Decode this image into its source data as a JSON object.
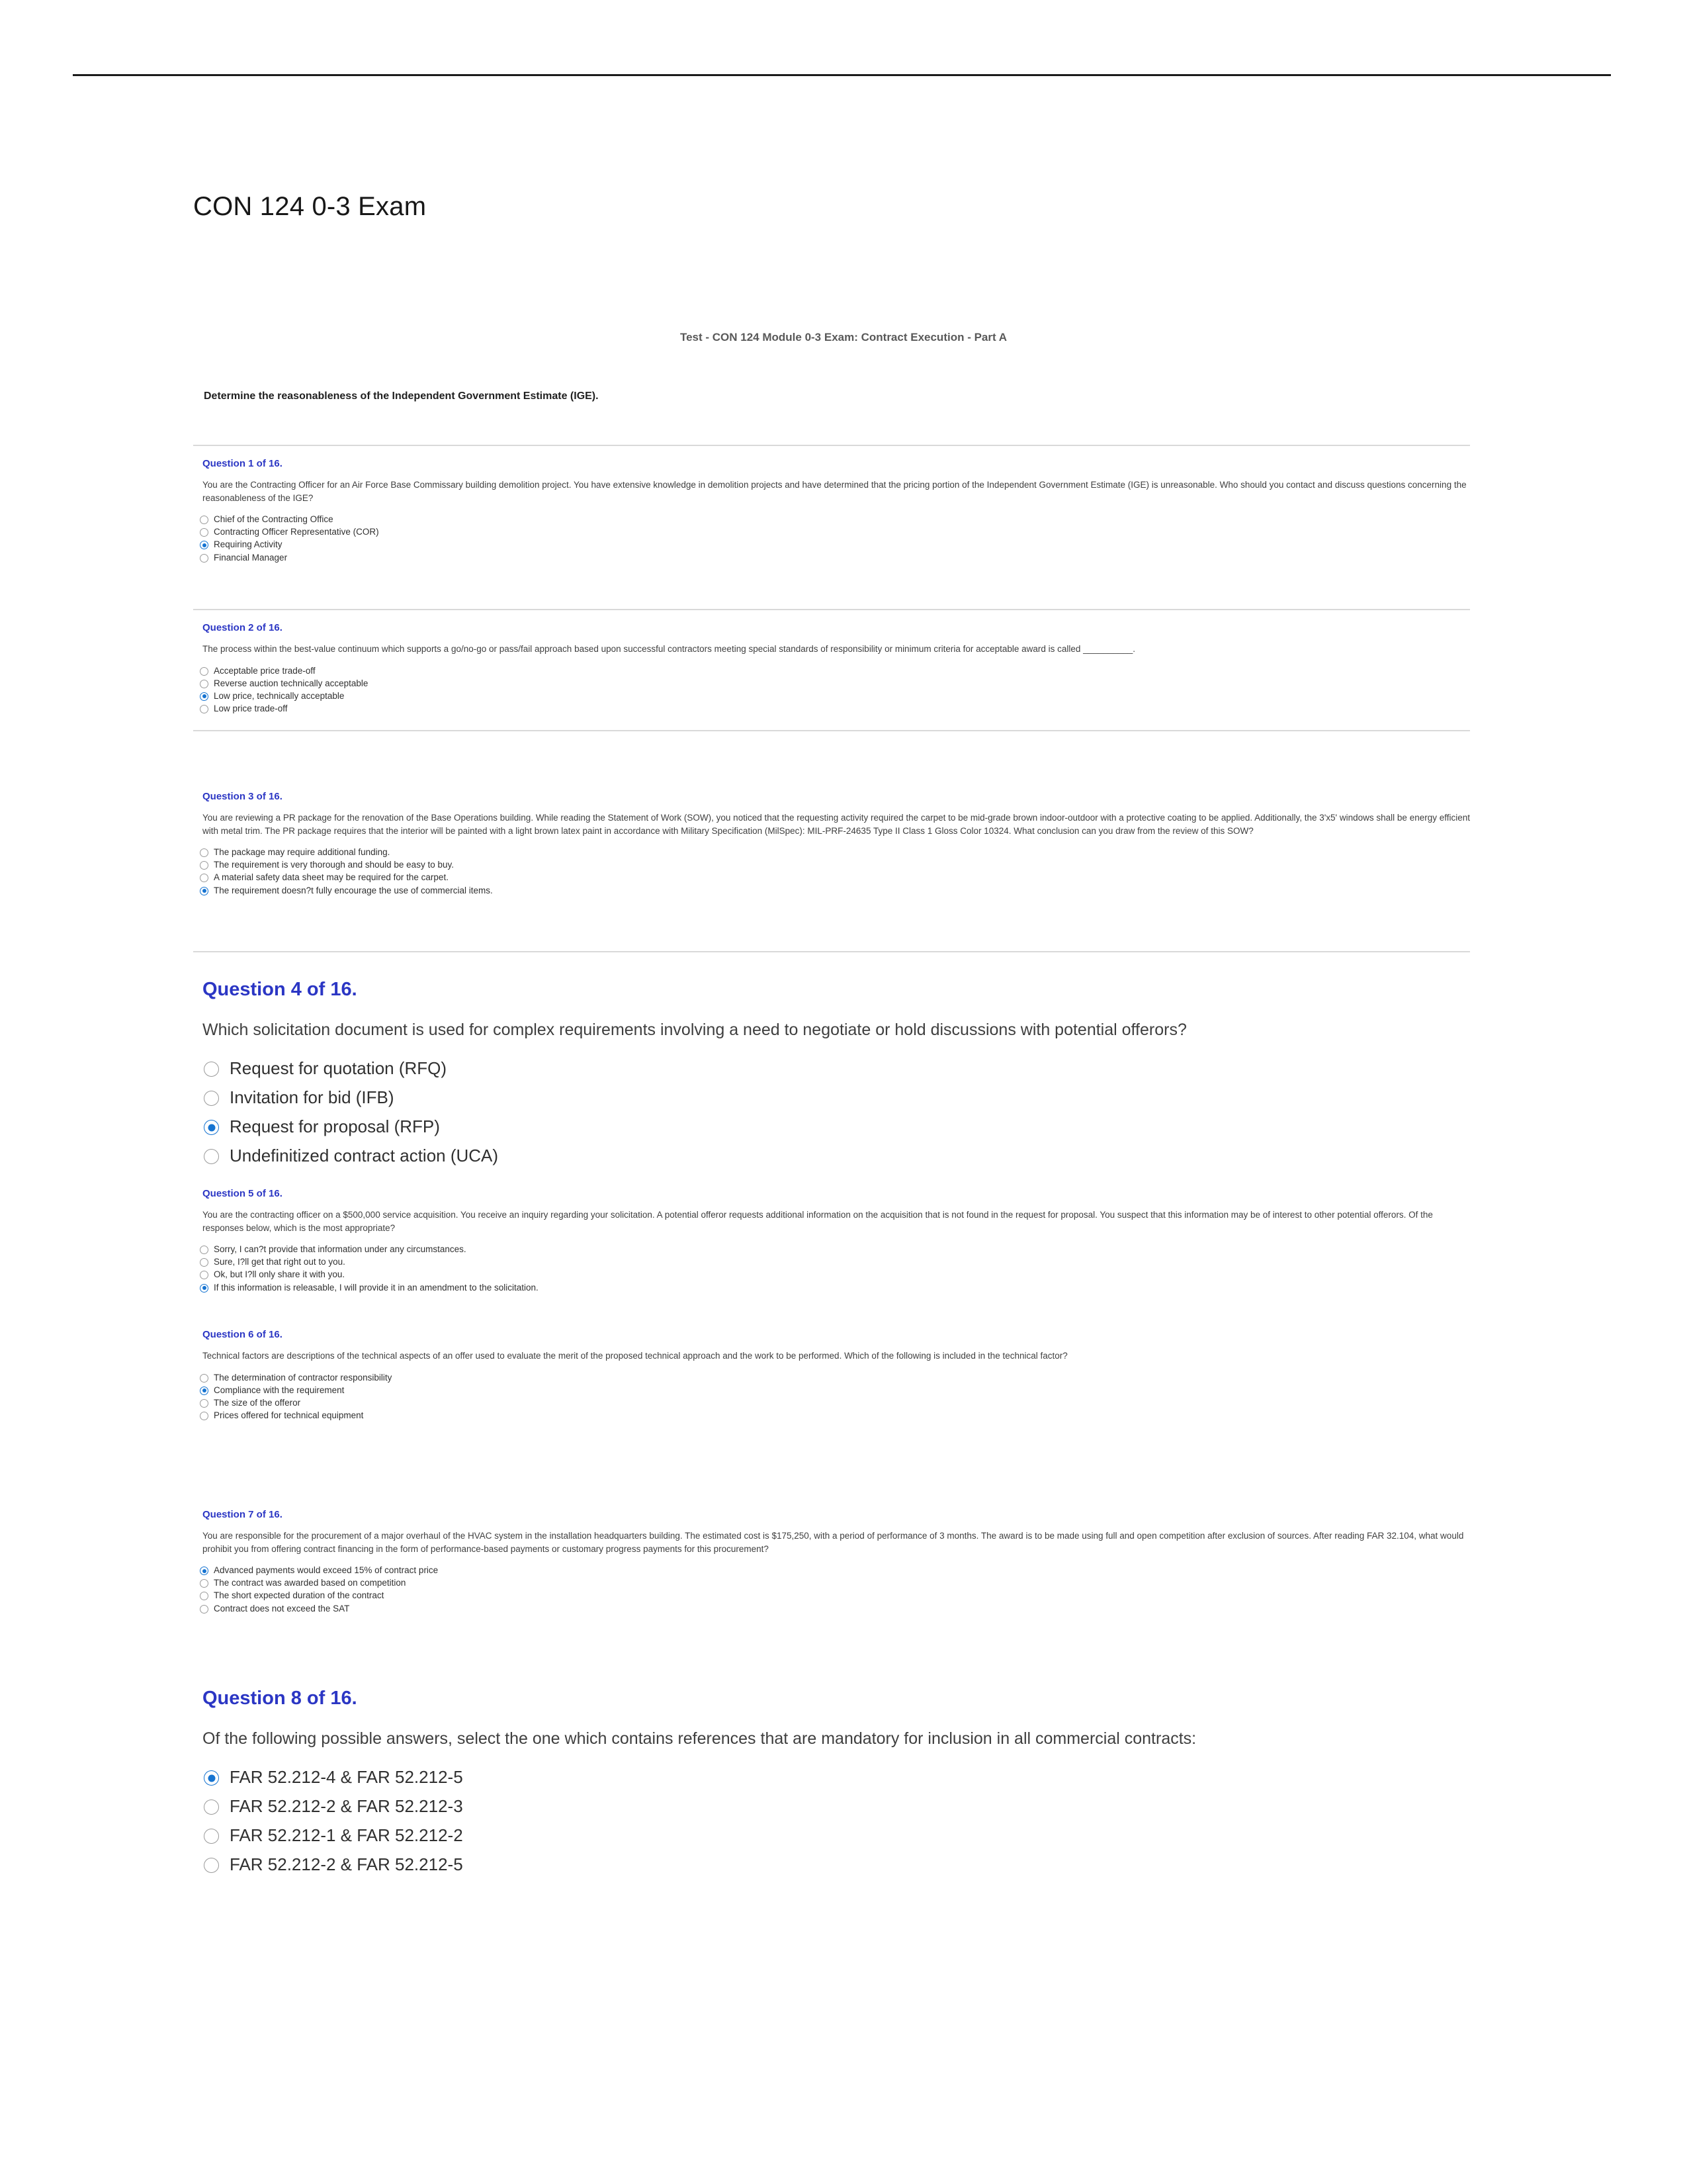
{
  "document": {
    "title": "CON 124 0-3 Exam",
    "exam_header": "Test - CON 124 Module 0-3 Exam: Contract Execution - Part A",
    "section_instruction": "Determine the reasonableness of the Independent Government Estimate (IGE).",
    "accent_color": "#2b36c4",
    "radio_selected_color": "#1674d1",
    "question_text_color": "#3f3f3f"
  },
  "questions": [
    {
      "label": "Question 1 of 16.",
      "text": "You are the Contracting Officer for an Air Force Base Commissary building demolition project. You have extensive knowledge in demolition projects and have determined that the pricing portion of the Independent Government Estimate (IGE) is unreasonable. Who should you contact and discuss questions concerning the reasonableness of the IGE?",
      "options": [
        {
          "label": "Chief of the Contracting Office",
          "selected": false
        },
        {
          "label": "Contracting Officer Representative (COR)",
          "selected": false
        },
        {
          "label": "Requiring Activity",
          "selected": true
        },
        {
          "label": "Financial Manager",
          "selected": false
        }
      ]
    },
    {
      "label": "Question 2 of 16.",
      "text": "The process within the best-value continuum which supports a go/no-go or pass/fail approach based upon successful contractors meeting special standards of responsibility or minimum criteria for acceptable award is called __________.",
      "options": [
        {
          "label": "Acceptable price trade-off",
          "selected": false
        },
        {
          "label": "Reverse auction technically acceptable",
          "selected": false
        },
        {
          "label": "Low price, technically acceptable",
          "selected": true
        },
        {
          "label": "Low price trade-off",
          "selected": false
        }
      ]
    },
    {
      "label": "Question 3 of 16.",
      "text": "You are reviewing a PR package for the renovation of the Base Operations building. While reading the Statement of Work (SOW), you noticed that the requesting activity required the carpet to be mid-grade brown indoor-outdoor with a protective coating to be applied. Additionally, the 3'x5' windows shall be energy efficient with metal trim. The PR package requires that the interior will be painted with a light brown latex paint in accordance with Military Specification (MilSpec): MIL-PRF-24635 Type II Class 1 Gloss Color 10324. What conclusion can you draw from the review of this SOW?",
      "options": [
        {
          "label": "The package may require additional funding.",
          "selected": false
        },
        {
          "label": "The requirement is very thorough and should be easy to buy.",
          "selected": false
        },
        {
          "label": "A material safety data sheet may be required for the carpet.",
          "selected": false
        },
        {
          "label": "The requirement doesn?t fully encourage the use of commercial items.",
          "selected": true
        }
      ]
    },
    {
      "label": "Question 4 of 16.",
      "text": "Which solicitation document is used for complex requirements involving a need to negotiate or hold discussions with potential offerors?",
      "options": [
        {
          "label": "Request for quotation (RFQ)",
          "selected": false
        },
        {
          "label": "Invitation for bid (IFB)",
          "selected": false
        },
        {
          "label": "Request for proposal (RFP)",
          "selected": true
        },
        {
          "label": "Undefinitized contract action (UCA)",
          "selected": false
        }
      ]
    },
    {
      "label": "Question 5 of 16.",
      "text": "You are the contracting officer on a $500,000 service acquisition. You receive an inquiry regarding your solicitation. A potential offeror requests additional information on the acquisition that is not found in the request for proposal. You suspect that this information may be of interest to other potential offerors. Of the responses below, which is the most appropriate?",
      "options": [
        {
          "label": "Sorry, I can?t provide that information under any circumstances.",
          "selected": false
        },
        {
          "label": "Sure, I?ll get that right out to you.",
          "selected": false
        },
        {
          "label": "Ok, but I?ll only share it with you.",
          "selected": false
        },
        {
          "label": "If this information is releasable, I will provide it in an amendment to the solicitation.",
          "selected": true
        }
      ]
    },
    {
      "label": "Question 6 of 16.",
      "text": "Technical factors are descriptions of the technical aspects of an offer used to evaluate the merit of the proposed technical approach and the work to be performed. Which of the following is included in the technical factor?",
      "options": [
        {
          "label": "The determination of contractor responsibility",
          "selected": false
        },
        {
          "label": "Compliance with the requirement",
          "selected": true
        },
        {
          "label": "The size of the offeror",
          "selected": false
        },
        {
          "label": "Prices offered for technical equipment",
          "selected": false
        }
      ]
    },
    {
      "label": "Question 7 of 16.",
      "text": "You are responsible for the procurement of a major overhaul of the HVAC system in the installation headquarters building. The estimated cost is $175,250, with a period of performance of 3 months. The award is to be made using full and open competition after exclusion of sources. After reading FAR 32.104, what would prohibit you from offering contract financing in the form of performance-based payments or customary progress payments for this procurement?",
      "options": [
        {
          "label": "Advanced payments would exceed 15% of contract price",
          "selected": true
        },
        {
          "label": "The contract was awarded based on competition",
          "selected": false
        },
        {
          "label": "The short expected duration of the contract",
          "selected": false
        },
        {
          "label": "Contract does not exceed the SAT",
          "selected": false
        }
      ]
    },
    {
      "label": "Question 8 of 16.",
      "text": "Of the following possible answers, select the one which contains references that are mandatory for inclusion in all commercial contracts:",
      "options": [
        {
          "label": "FAR 52.212-4 & FAR 52.212-5",
          "selected": true
        },
        {
          "label": "FAR 52.212-2 & FAR 52.212-3",
          "selected": false
        },
        {
          "label": "FAR 52.212-1 & FAR 52.212-2",
          "selected": false
        },
        {
          "label": "FAR 52.212-2 & FAR 52.212-5",
          "selected": false
        }
      ]
    }
  ]
}
